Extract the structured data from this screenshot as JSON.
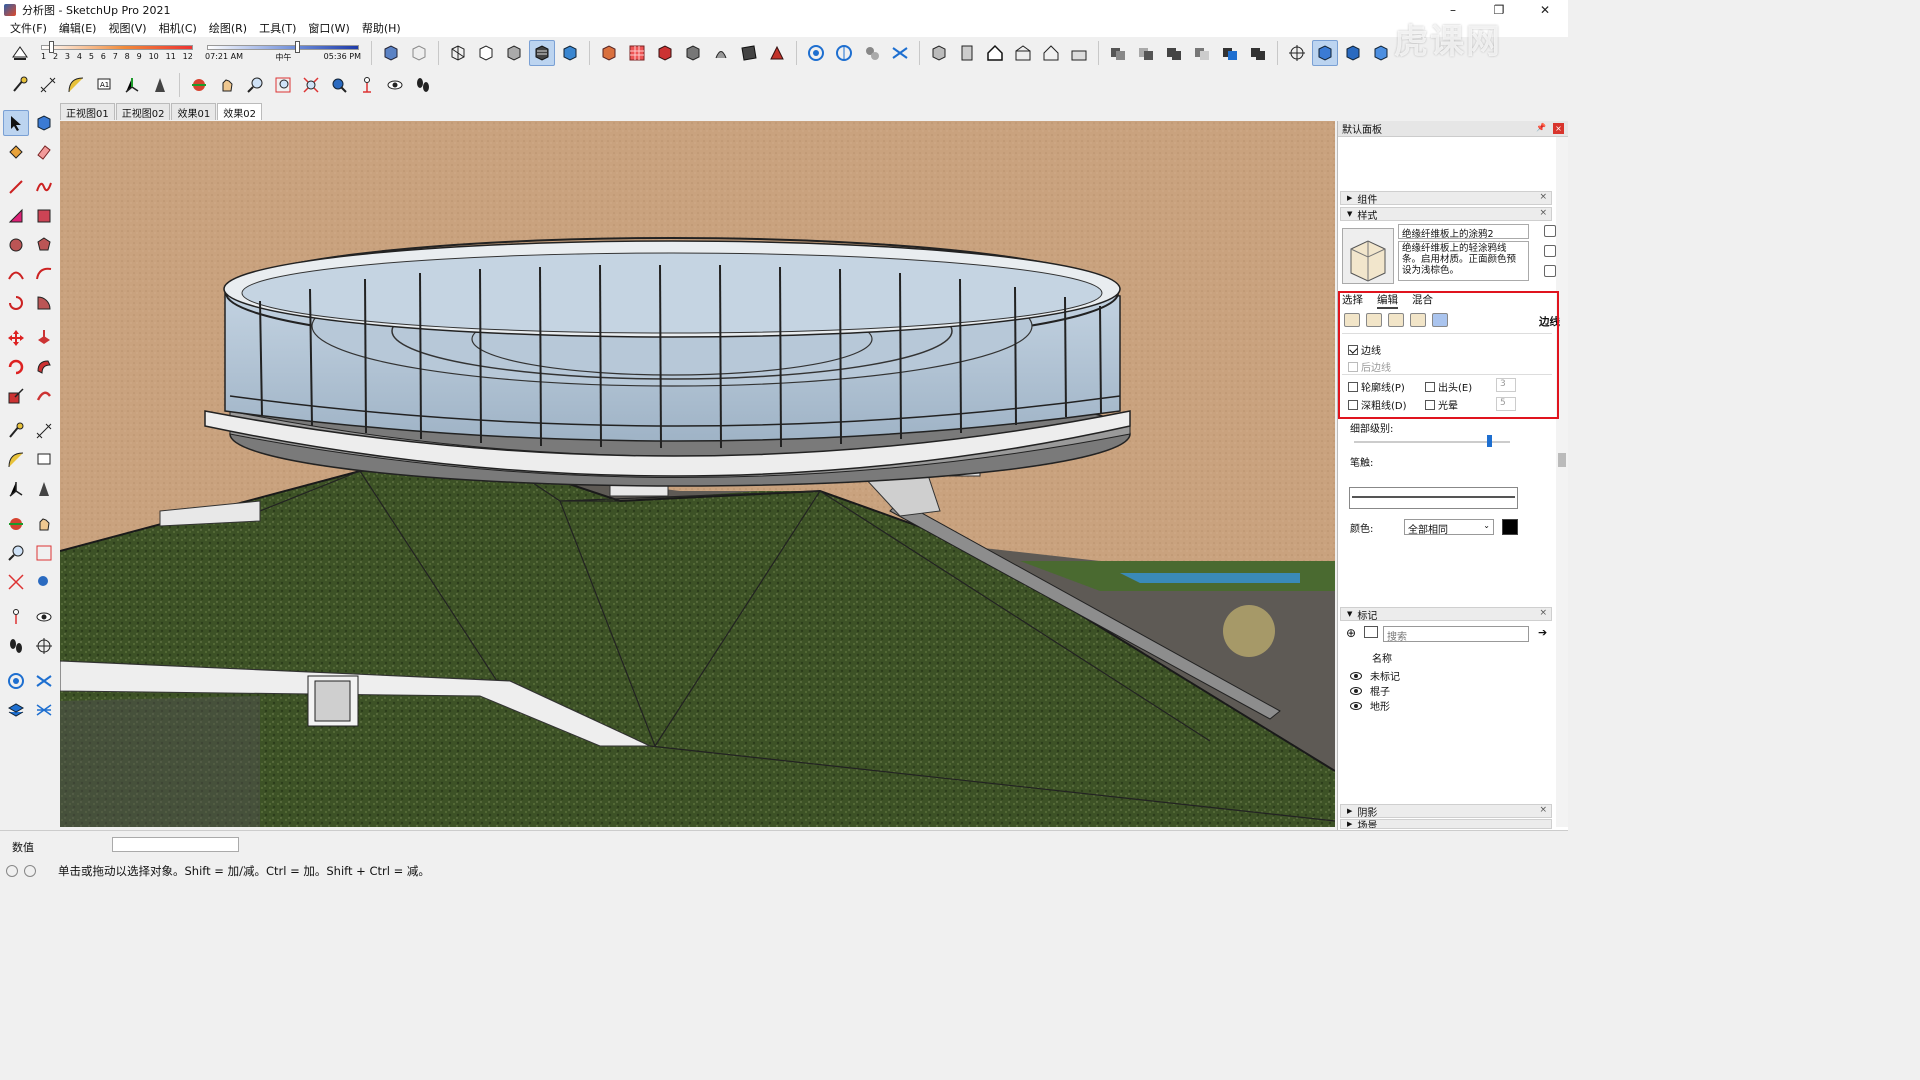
{
  "window": {
    "title": "分析图 - SketchUp Pro 2021",
    "minimize": "–",
    "restore": "❐",
    "close": "✕"
  },
  "menu": [
    "文件(F)",
    "编辑(E)",
    "视图(V)",
    "相机(C)",
    "绘图(R)",
    "工具(T)",
    "窗口(W)",
    "帮助(H)"
  ],
  "shadow": {
    "months": [
      "1",
      "2",
      "3",
      "4",
      "5",
      "6",
      "7",
      "8",
      "9",
      "10",
      "11",
      "12"
    ],
    "time_start": "07:21 AM",
    "time_mid": "中午",
    "time_end": "05:36 PM"
  },
  "scene_tabs": [
    "正视图01",
    "正视图02",
    "效果01",
    "效果02"
  ],
  "panel": {
    "title": "默认面板",
    "components": "组件",
    "styles": "样式",
    "style_name": "绝缘纤维板上的涂鸦2",
    "style_desc": "绝缘纤维板上的轻涂鸦线条。启用材质。正面颜色预设为浅棕色。",
    "tabs": [
      "选择",
      "编辑",
      "混合"
    ],
    "edit_section": "边线",
    "edges": "边线",
    "back_edges": "后边线",
    "profiles": "轮廓线(P)",
    "extension": "出头(E)",
    "extension_value": "3",
    "depth_cue": "深粗线(D)",
    "halo": "光晕",
    "halo_value": "5",
    "level_of_detail": "细部级别:",
    "stroke": "笔触:",
    "color_label": "颜色:",
    "color_value": "全部相同",
    "tags": "标记",
    "search_placeholder": "搜索",
    "name_header": "名称",
    "tag_items": [
      "未标记",
      "棍子",
      "地形"
    ],
    "shadows": "阴影",
    "scenes": "场景"
  },
  "status": {
    "measurements_label": "数值",
    "hint": "单击或拖动以选择对象。Shift = 加/减。Ctrl = 加。Shift + Ctrl = 减。"
  },
  "watermark": "虎课网"
}
